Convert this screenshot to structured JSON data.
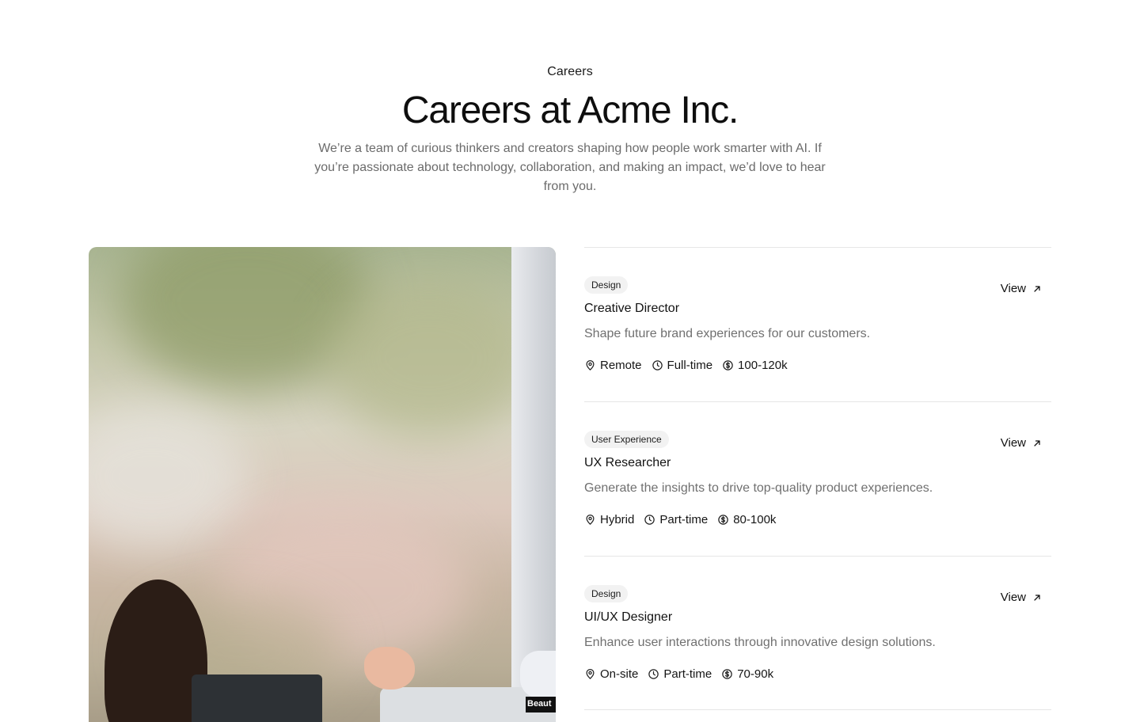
{
  "header": {
    "eyebrow": "Careers",
    "title": "Careers at Acme Inc.",
    "subtitle": "We’re a team of curious thinkers and creators shaping how people work smarter with AI. If you’re passionate about technology, collaboration, and making an impact, we’d love to hear from you."
  },
  "photo": {
    "sticker_text": "Beaut"
  },
  "jobs": [
    {
      "tag": "Design",
      "title": "Creative Director",
      "description": "Shape future brand experiences for our customers.",
      "location": "Remote",
      "type": "Full-time",
      "salary": "100-120k",
      "view_label": "View"
    },
    {
      "tag": "User Experience",
      "title": "UX Researcher",
      "description": "Generate the insights to drive top-quality product experiences.",
      "location": "Hybrid",
      "type": "Part-time",
      "salary": "80-100k",
      "view_label": "View"
    },
    {
      "tag": "Design",
      "title": "UI/UX Designer",
      "description": "Enhance user interactions through innovative design solutions.",
      "location": "On-site",
      "type": "Part-time",
      "salary": "70-90k",
      "view_label": "View"
    }
  ],
  "icons": {
    "location": "map-pin-icon",
    "type": "clock-icon",
    "salary": "dollar-circle-icon",
    "view": "arrow-up-right-icon"
  }
}
